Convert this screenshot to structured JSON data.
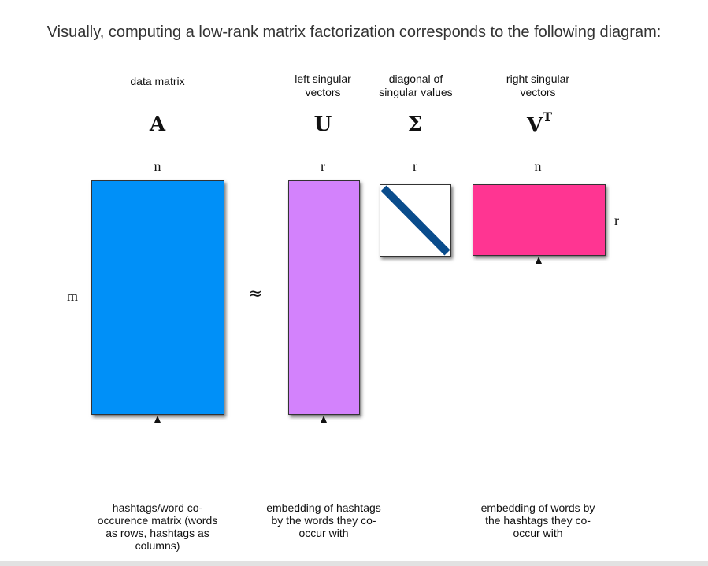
{
  "intro": "Visually, computing a low-rank matrix factorization corresponds to the following diagram:",
  "headers": {
    "data_matrix": "data matrix",
    "left_singular": [
      "left singular",
      "vectors"
    ],
    "diagonal": [
      "diagonal of",
      "singular values"
    ],
    "right_singular": [
      "right singular",
      "vectors"
    ]
  },
  "symbols": {
    "A": "A",
    "U": "U",
    "Sigma": "Σ",
    "V": "V",
    "V_sup": "T"
  },
  "dims": {
    "A_cols": "n",
    "U_cols": "r",
    "Sigma_cols": "r",
    "VT_cols": "n",
    "VT_rows": "r",
    "A_rows": "m"
  },
  "approx": "≈",
  "colors": {
    "A": "#0090f8",
    "U": "#d382fc",
    "Sigma_fill": "#ffffff",
    "Sigma_diag": "#0a4c8c",
    "VT": "#ff3592"
  },
  "descriptions": {
    "A": [
      "hashtags/word co-",
      "occurence matrix (words",
      "as rows, hashtags as",
      "columns)"
    ],
    "U": [
      "embedding of hashtags",
      "by the words they co-",
      "occur with"
    ],
    "VT": [
      "embedding of words by",
      "the hashtags they co-",
      "occur with"
    ]
  }
}
